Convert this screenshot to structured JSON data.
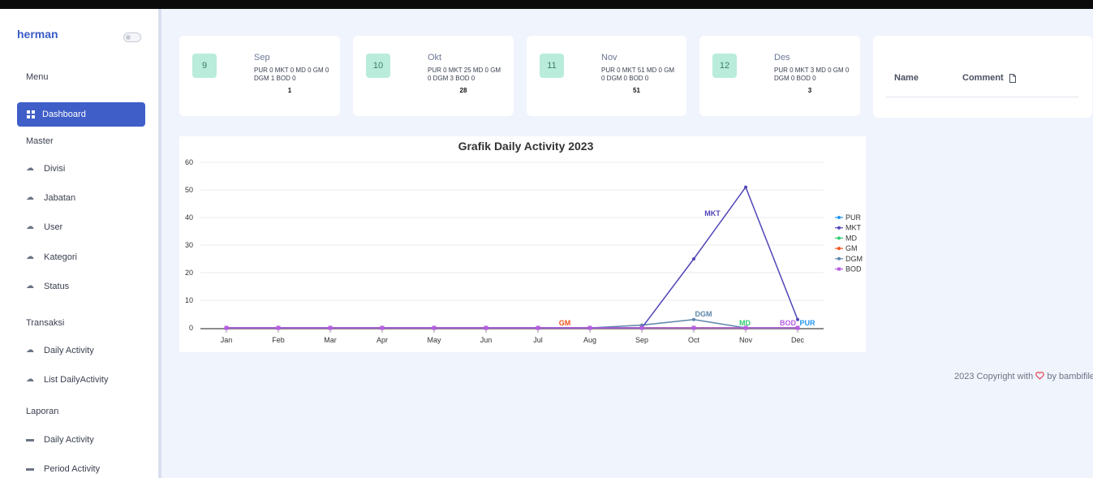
{
  "app": {
    "user": "herman"
  },
  "sidebar": {
    "sections": {
      "menu": "Menu",
      "master": "Master",
      "transaksi": "Transaksi",
      "laporan": "Laporan"
    },
    "active": "Dashboard",
    "master_items": [
      "Divisi",
      "Jabatan",
      "User",
      "Kategori",
      "Status"
    ],
    "transaksi_items": [
      "Daily Activity",
      "List DailyActivity"
    ],
    "laporan_items": [
      "Daily Activity",
      "Period Activity"
    ]
  },
  "cards": [
    {
      "num": "9",
      "month": "Sep",
      "detail": "PUR 0 MKT 0 MD 0 GM 0 DGM 1 BOD 0",
      "total": "1"
    },
    {
      "num": "10",
      "month": "Okt",
      "detail": "PUR 0 MKT 25 MD 0 GM 0 DGM 3 BOD 0",
      "total": "28"
    },
    {
      "num": "11",
      "month": "Nov",
      "detail": "PUR 0 MKT 51 MD 0 GM 0 DGM 0 BOD 0",
      "total": "51"
    },
    {
      "num": "12",
      "month": "Des",
      "detail": "PUR 0 MKT 3 MD 0 GM 0 DGM 0 BOD 0",
      "total": "3"
    }
  ],
  "comments": {
    "col_name": "Name",
    "col_comment": "Comment"
  },
  "footer": {
    "prefix": "2023 Copyright with",
    "suffix": "by bambifile"
  },
  "chart_data": {
    "type": "line",
    "title": "Grafik Daily Activity 2023",
    "categories": [
      "Jan",
      "Feb",
      "Mar",
      "Apr",
      "May",
      "Jun",
      "Jul",
      "Aug",
      "Sep",
      "Oct",
      "Nov",
      "Dec"
    ],
    "ylim": [
      0,
      60
    ],
    "yticks": [
      0,
      10,
      20,
      30,
      40,
      50,
      60
    ],
    "legend_position": "right",
    "series": [
      {
        "name": "PUR",
        "color": "#2196f3",
        "values": [
          0,
          0,
          0,
          0,
          0,
          0,
          0,
          0,
          0,
          0,
          0,
          0
        ],
        "label": "PUR"
      },
      {
        "name": "MKT",
        "color": "#5046b8",
        "values": [
          0,
          0,
          0,
          0,
          0,
          0,
          0,
          0,
          0,
          25,
          51,
          3
        ],
        "label": "MKT"
      },
      {
        "name": "MD",
        "color": "#2ecc71",
        "values": [
          0,
          0,
          0,
          0,
          0,
          0,
          0,
          0,
          0,
          0,
          0,
          0
        ],
        "label": "MD"
      },
      {
        "name": "GM",
        "color": "#f4511e",
        "values": [
          0,
          0,
          0,
          0,
          0,
          0,
          0,
          0,
          0,
          0,
          0,
          0
        ],
        "label": "GM"
      },
      {
        "name": "DGM",
        "color": "#5b86a8",
        "values": [
          0,
          0,
          0,
          0,
          0,
          0,
          0,
          0,
          1,
          3,
          0,
          0
        ],
        "label": "DGM"
      },
      {
        "name": "BOD",
        "color": "#b65de0",
        "values": [
          0,
          0,
          0,
          0,
          0,
          0,
          0,
          0,
          0,
          0,
          0,
          0
        ],
        "label": "BOD"
      }
    ]
  }
}
